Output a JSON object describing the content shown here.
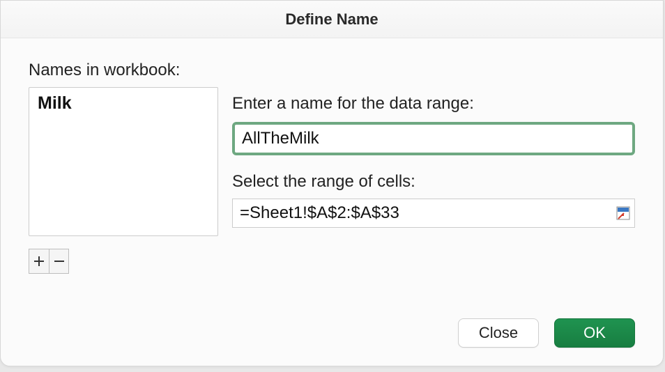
{
  "dialog": {
    "title": "Define Name"
  },
  "left": {
    "label": "Names in workbook:",
    "items": [
      {
        "label": "Milk"
      }
    ]
  },
  "right": {
    "name_label": "Enter a name for the data range:",
    "name_value": "AllTheMilk",
    "range_label": "Select the range of cells:",
    "range_value": "=Sheet1!$A$2:$A$33"
  },
  "buttons": {
    "close": "Close",
    "ok": "OK"
  },
  "colors": {
    "accent_green": "#1e8c4a",
    "input_focus_border": "#6ea881"
  },
  "icons": {
    "plus": "plus-icon",
    "minus": "minus-icon",
    "range_picker": "range-picker-icon"
  }
}
